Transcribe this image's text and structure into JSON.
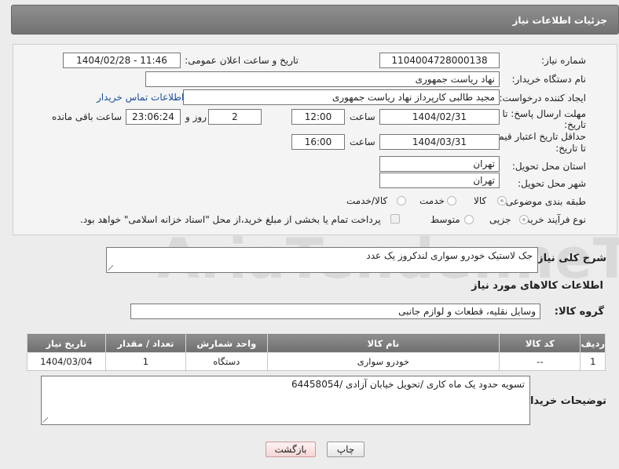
{
  "header": {
    "title": "جزئیات اطلاعات نیاز"
  },
  "form": {
    "need_number_label": "شماره نیاز:",
    "need_number": "1104004728000138",
    "announce_label": "تاریخ و ساعت اعلان عمومی:",
    "announce_value": "1404/02/28 - 11:46",
    "buyer_org_label": "نام دستگاه خریدار:",
    "buyer_org": "نهاد ریاست جمهوری",
    "requester_label": "ایجاد کننده درخواست:",
    "requester": "مجید طالبی کارپرداز نهاد ریاست جمهوری",
    "contact_link": "اطلاعات تماس خریدار",
    "reply_deadline_label_1": "مهلت ارسال پاسخ: تا",
    "reply_deadline_label_2": "تاریخ:",
    "reply_date": "1404/02/31",
    "hour_label": "ساعت",
    "reply_time": "12:00",
    "days_value": "2",
    "days_label": "روز و",
    "remaining_time": "23:06:24",
    "remaining_label": "ساعت باقی مانده",
    "price_validity_label_1": "حداقل تاریخ اعتبار قیمت:",
    "price_validity_label_2": "تا تاریخ:",
    "price_date": "1404/03/31",
    "price_time": "16:00",
    "province_label": "استان محل تحویل:",
    "province": "تهران",
    "city_label": "شهر محل تحویل:",
    "city": "تهران",
    "category_label": "طبقه بندی موضوعی:",
    "category_options": [
      "کالا",
      "خدمت",
      "کالا/خدمت"
    ],
    "purchase_type_label": "نوع فرآیند خرید :",
    "purchase_options": [
      "جزیی",
      "متوسط"
    ],
    "payment_note": "پرداخت تمام یا بخشی از مبلغ خرید،از محل \"اسناد خزانه اسلامی\" خواهد بود."
  },
  "description": {
    "label": "شرح کلی نیاز:",
    "value": "جک لاستیک خودرو سواری لندکروز یک عدد"
  },
  "goods_section": {
    "title": "اطلاعات کالاهای مورد نیاز",
    "group_label": "گروه کالا:",
    "group_value": "وسایل نقلیه، قطعات و لوازم جانبی"
  },
  "table": {
    "headers": [
      "ردیف",
      "کد کالا",
      "نام کالا",
      "واحد شمارش",
      "تعداد / مقدار",
      "تاریخ نیاز"
    ],
    "rows": [
      [
        "1",
        "--",
        "خودرو سواری",
        "دستگاه",
        "1",
        "1404/03/04"
      ]
    ]
  },
  "buyer_notes": {
    "label": "توضیحات خریدار:",
    "value": "تسویه حدود یک ماه کاری /تحویل خیابان آزادی /64458054"
  },
  "buttons": {
    "print": "چاپ",
    "back": "بازگشت"
  },
  "watermark": {
    "text": "AriaTender.neT"
  },
  "colors": {
    "header_bg": "#7f7f7f",
    "link": "#1a4fa0",
    "back_button": "#f6d4d4"
  }
}
